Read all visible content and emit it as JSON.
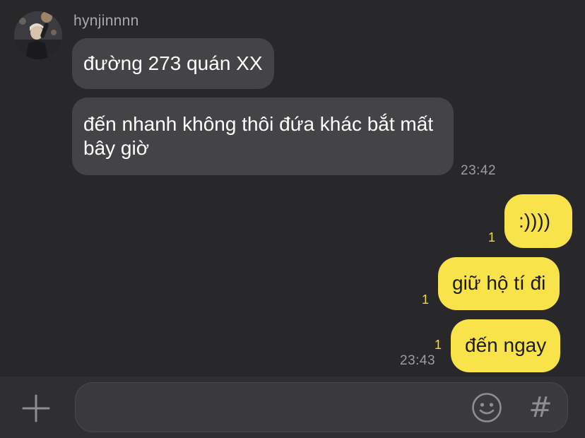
{
  "header": {
    "sender_name": "hynjinnnn"
  },
  "messages": [
    {
      "direction": "incoming",
      "text": "đường 273 quán XX"
    },
    {
      "direction": "incoming",
      "text": "đến nhanh không thôi đứa khác bắt mất bây giờ",
      "time": "23:42"
    },
    {
      "direction": "outgoing",
      "text": ":))))",
      "unread": "1"
    },
    {
      "direction": "outgoing",
      "text": "giữ hộ tí đi",
      "unread": "1"
    },
    {
      "direction": "outgoing",
      "text": "đến ngay",
      "unread": "1",
      "time": "23:43"
    }
  ],
  "input_bar": {
    "placeholder": "",
    "value": "",
    "hash_label": "#",
    "icons": [
      "plus-icon",
      "emoji-icon",
      "hash-icon"
    ]
  },
  "colors": {
    "background": "#28282a",
    "incoming_bubble": "#444447",
    "outgoing_bubble": "#f9e34b",
    "unread_count": "#f4d83b",
    "timestamp": "#9d9da1"
  }
}
